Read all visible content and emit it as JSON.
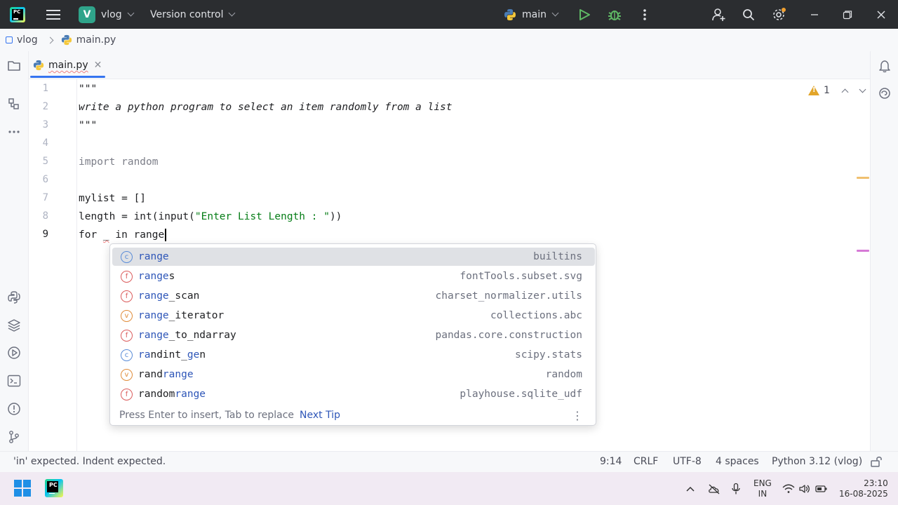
{
  "titlebar": {
    "project_badge": "V",
    "project_name": "vlog",
    "vcs_label": "Version control",
    "run_config": "main",
    "icons": [
      "hamburger-menu-icon",
      "play-icon",
      "bug-icon",
      "more-vertical-icon",
      "add-user-icon",
      "search-icon",
      "gear-icon",
      "minimize-icon",
      "restore-icon",
      "close-icon"
    ],
    "colors": {
      "bg": "#2b2d30",
      "play": "#5fb865",
      "debug": "#5fb865"
    }
  },
  "breadcrumb": {
    "project": "vlog",
    "file": "main.py"
  },
  "tabs": [
    {
      "label": "main.py",
      "active": true
    }
  ],
  "editor": {
    "lines": [
      {
        "num": "1",
        "text": "\"\"\""
      },
      {
        "num": "2",
        "text": "write a python program to select an item randomly from a list"
      },
      {
        "num": "3",
        "text": "\"\"\""
      },
      {
        "num": "4",
        "text": ""
      },
      {
        "num": "5",
        "text": "import random"
      },
      {
        "num": "6",
        "text": ""
      },
      {
        "num": "7",
        "text": "mylist = []"
      },
      {
        "num": "8a",
        "text": "length = int(input("
      },
      {
        "num": "8b",
        "text": "\"Enter List Length : \""
      },
      {
        "num": "8c",
        "text": "))"
      },
      {
        "num": "9a",
        "text": "for "
      },
      {
        "num": "9b",
        "text": "_"
      },
      {
        "num": "9c",
        "text": " in range"
      }
    ],
    "line_numbers": [
      "1",
      "2",
      "3",
      "4",
      "5",
      "6",
      "7",
      "8",
      "9"
    ],
    "inspection_count": "1"
  },
  "completion": {
    "items": [
      {
        "kind": "c",
        "match": "range",
        "rest": "",
        "source": "builtins"
      },
      {
        "kind": "f",
        "match": "range",
        "rest": "s",
        "source": "fontTools.subset.svg"
      },
      {
        "kind": "f",
        "match": "range",
        "rest": "_scan",
        "source": "charset_normalizer.utils"
      },
      {
        "kind": "v",
        "match": "range",
        "rest": "_iterator",
        "source": "collections.abc"
      },
      {
        "kind": "f",
        "match": "range",
        "rest": "_to_ndarray",
        "source": "pandas.core.construction"
      },
      {
        "kind": "c",
        "prefix": "",
        "match": "ra",
        "mid": "ndint_",
        "match2": "ge",
        "rest": "n",
        "source": "scipy.stats"
      },
      {
        "kind": "v",
        "prefix": "rand",
        "match": "range",
        "rest": "",
        "source": "random"
      },
      {
        "kind": "f",
        "prefix": "random",
        "match": "range",
        "rest": "",
        "source": "playhouse.sqlite_udf"
      }
    ],
    "footer_hint": "Press Enter to insert, Tab to replace",
    "next_tip": "Next Tip"
  },
  "statusbar": {
    "message": "'in' expected. Indent expected.",
    "position": "9:14",
    "line_sep": "CRLF",
    "encoding": "UTF-8",
    "indent": "4 spaces",
    "interpreter": "Python 3.12 (vlog)"
  },
  "taskbar": {
    "lang_top": "ENG",
    "lang_bottom": "IN",
    "time": "23:10",
    "date": "16-08-2025"
  }
}
